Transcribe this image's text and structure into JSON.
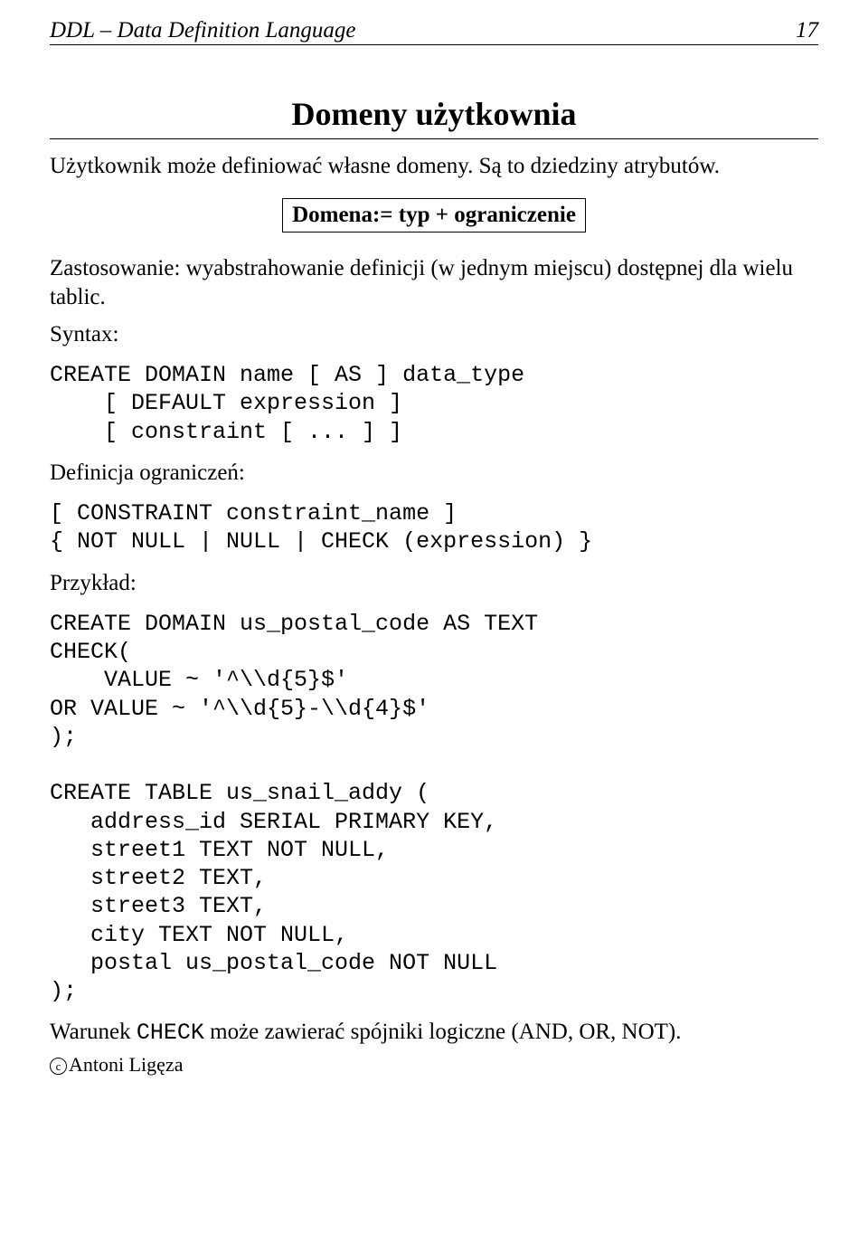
{
  "header": {
    "left": "DDL – Data Definition Language",
    "right": "17"
  },
  "title": "Domeny użytkownia",
  "intro": "Użytkownik może definiować własne domeny. Są to dziedziny atrybutów.",
  "box_text": "Domena:= typ + ograniczenie",
  "usage": "Zastosowanie: wyabstrahowanie definicji (w jednym miejscu) dostępnej dla wielu tablic.",
  "syntax_label": "Syntax:",
  "syntax_code": "CREATE DOMAIN name [ AS ] data_type\n    [ DEFAULT expression ]\n    [ constraint [ ... ] ]",
  "constraints_label": "Definicja ograniczeń:",
  "constraints_code": "[ CONSTRAINT constraint_name ]\n{ NOT NULL | NULL | CHECK (expression) }",
  "example_label": "Przykład:",
  "example_code": "CREATE DOMAIN us_postal_code AS TEXT\nCHECK(\n    VALUE ~ '^\\\\d{5}$'\nOR VALUE ~ '^\\\\d{5}-\\\\d{4}$'\n);\n\nCREATE TABLE us_snail_addy (\n   address_id SERIAL PRIMARY KEY,\n   street1 TEXT NOT NULL,\n   street2 TEXT,\n   street3 TEXT,\n   city TEXT NOT NULL,\n   postal us_postal_code NOT NULL\n);",
  "warning_prefix": "Warunek ",
  "warning_code": "CHECK",
  "warning_suffix": " może zawierać spójniki logiczne (AND, OR, NOT).",
  "footer_author": "Antoni Ligęza"
}
